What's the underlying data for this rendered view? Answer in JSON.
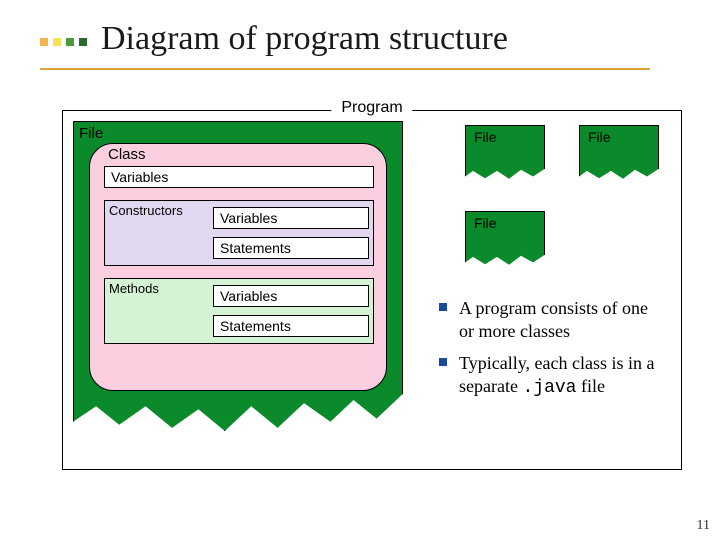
{
  "title": "Diagram of program structure",
  "frame_legend": "Program",
  "main_file": {
    "label": "File",
    "class_label": "Class",
    "variables_label": "Variables",
    "constructors": {
      "label": "Constructors",
      "variables": "Variables",
      "statements": "Statements"
    },
    "methods": {
      "label": "Methods",
      "variables": "Variables",
      "statements": "Statements"
    }
  },
  "other_files": [
    {
      "label": "File"
    },
    {
      "label": "File"
    },
    {
      "label": "File"
    }
  ],
  "bullets": [
    {
      "text_before": "A program consists of one or more classes",
      "mono": "",
      "text_after": ""
    },
    {
      "text_before": "Typically, each class is in a separate ",
      "mono": ".java",
      "text_after": " file"
    }
  ],
  "page_number": "11"
}
